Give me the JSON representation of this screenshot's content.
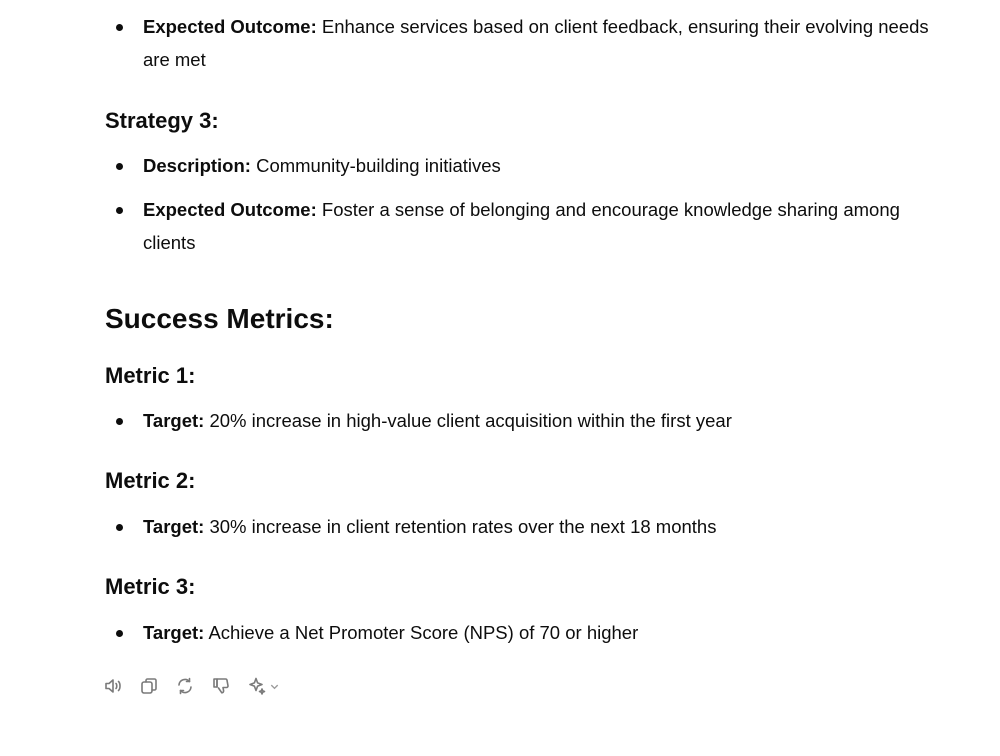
{
  "strategy2_tail": {
    "items": [
      {
        "label": "Expected Outcome:",
        "text": " Enhance services based on client feedback, ensuring their evolving needs are met"
      }
    ]
  },
  "strategy3": {
    "heading": "Strategy 3:",
    "items": [
      {
        "label": "Description:",
        "text": " Community-building initiatives"
      },
      {
        "label": "Expected Outcome:",
        "text": " Foster a sense of belonging and encourage knowledge sharing among clients"
      }
    ]
  },
  "success_metrics": {
    "heading": "Success Metrics:",
    "metrics": [
      {
        "heading": "Metric 1:",
        "label": "Target:",
        "text": " 20% increase in high-value client acquisition within the first year"
      },
      {
        "heading": "Metric 2:",
        "label": "Target:",
        "text": " 30% increase in client retention rates over the next 18 months"
      },
      {
        "heading": "Metric 3:",
        "label": "Target:",
        "text": " Achieve a Net Promoter Score (NPS) of 70 or higher"
      }
    ]
  },
  "toolbar": {
    "icons": [
      "read-aloud-icon",
      "copy-icon",
      "regenerate-icon",
      "thumbs-down-icon",
      "sparkle-icon",
      "chevron-down-icon"
    ]
  }
}
